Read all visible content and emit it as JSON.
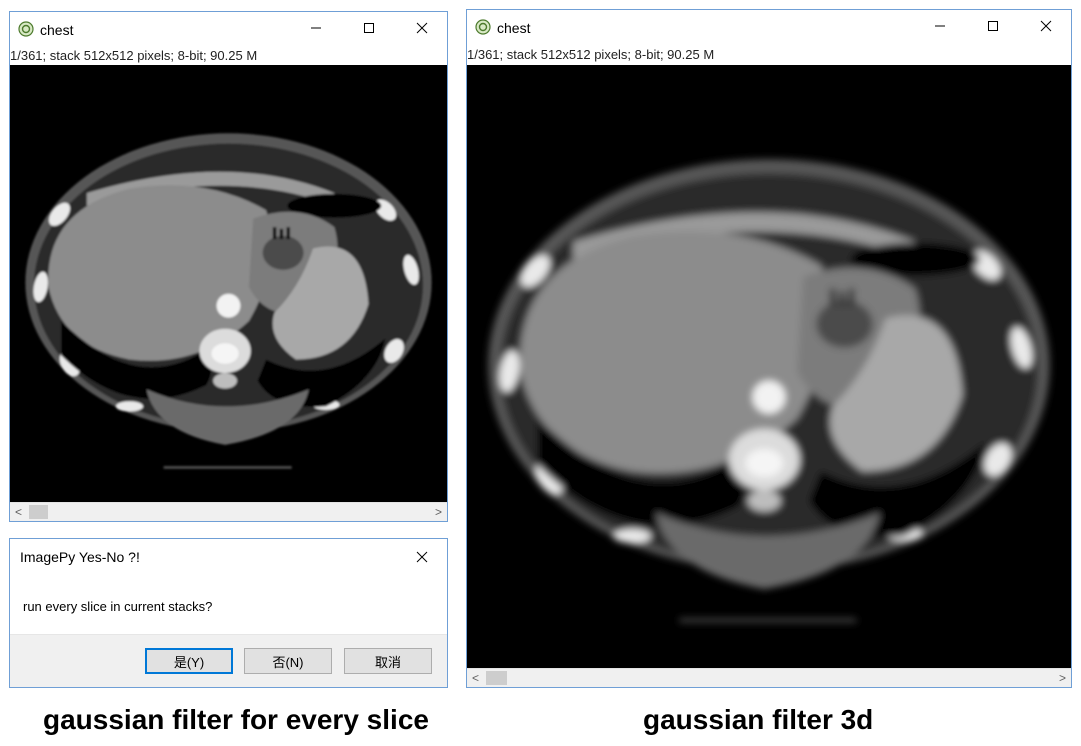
{
  "window_left": {
    "title": "chest",
    "info": "1/361; stack  512x512 pixels; 8-bit; 90.25 M",
    "scroll_left": "<",
    "scroll_right": ">"
  },
  "window_right": {
    "title": "chest",
    "info": "1/361; stack  512x512 pixels; 8-bit; 90.25 M",
    "scroll_left": "<",
    "scroll_right": ">"
  },
  "dialog": {
    "title": "ImagePy Yes-No ?!",
    "message": "run every slice in current stacks?",
    "buttons": {
      "yes": "是(Y)",
      "no": "否(N)",
      "cancel": "取消"
    }
  },
  "captions": {
    "left": "gaussian filter for every slice",
    "right": "gaussian filter 3d"
  },
  "colors": {
    "window_border": "#6f9fd6",
    "canvas_bg": "#000000",
    "default_button": "#0078d7"
  },
  "icons": {
    "app": "imagepy-logo-icon",
    "minimize": "minimize-icon",
    "maximize": "maximize-icon",
    "close": "close-icon"
  }
}
